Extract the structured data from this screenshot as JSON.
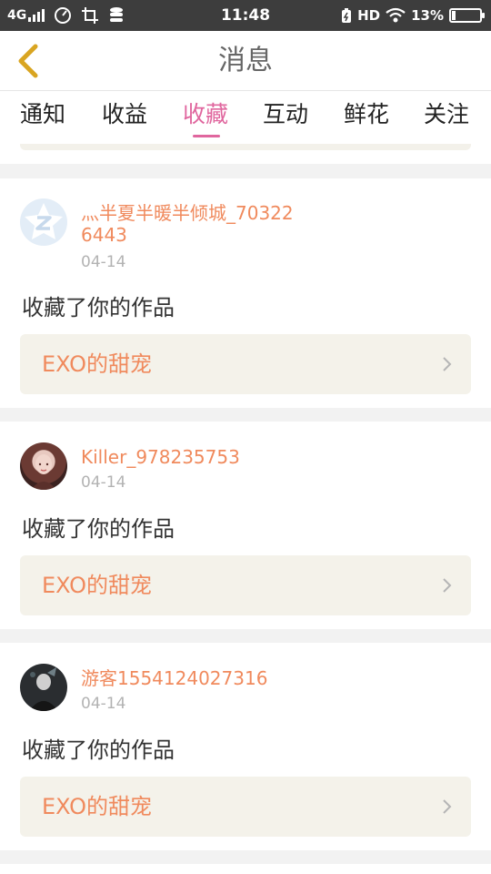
{
  "status_bar": {
    "network": "4G",
    "time": "11:48",
    "hd": "HD",
    "battery": "13%",
    "battery_level": 0.13
  },
  "header": {
    "title": "消息"
  },
  "tabs": [
    {
      "label": "通知"
    },
    {
      "label": "收益"
    },
    {
      "label": "收藏"
    },
    {
      "label": "互动"
    },
    {
      "label": "鲜花"
    },
    {
      "label": "关注"
    }
  ],
  "active_tab": "收藏",
  "messages": [
    {
      "user": "灬半夏半暖半倾城_703226443",
      "avatar_icon": "qq-default-avatar-icon",
      "date": "04-14",
      "text": "收藏了你的作品",
      "work_title": "EXO的甜宠"
    },
    {
      "user": "Killer_978235753",
      "avatar_icon": "user-photo-avatar",
      "date": "04-14",
      "text": "收藏了你的作品",
      "work_title": "EXO的甜宠"
    },
    {
      "user": "游客1554124027316",
      "avatar_icon": "user-photo-avatar",
      "date": "04-14",
      "text": "收藏了你的作品",
      "work_title": "EXO的甜宠"
    }
  ],
  "colors": {
    "accent": "#e0669e",
    "username": "#f08a5d",
    "back_arrow": "#d9a521"
  }
}
